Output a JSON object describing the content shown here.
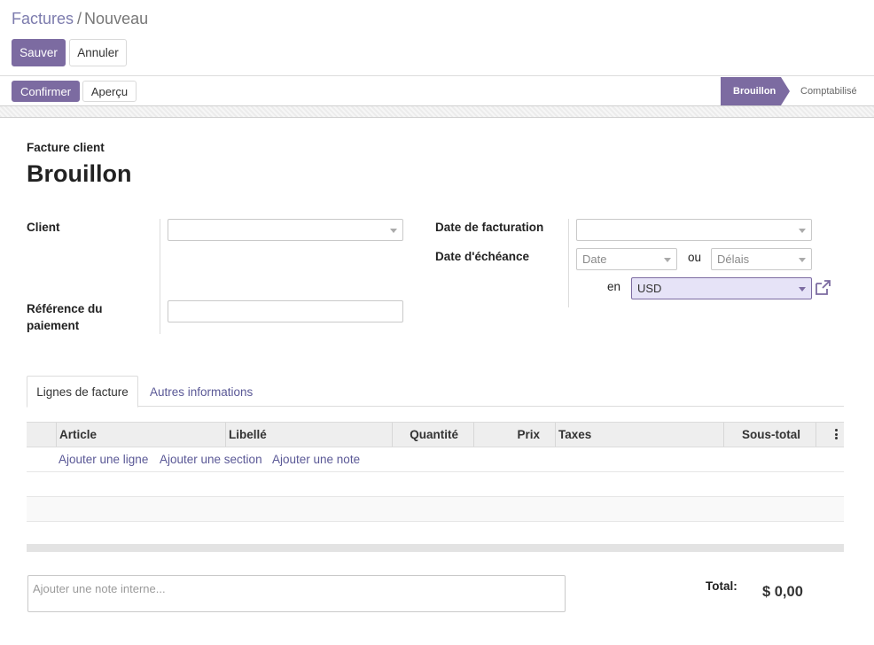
{
  "breadcrumb": {
    "parent": "Factures",
    "separator": "/",
    "current": "Nouveau"
  },
  "control_panel": {
    "save_label": "Sauver",
    "discard_label": "Annuler"
  },
  "statusbar": {
    "confirm_label": "Confirmer",
    "preview_label": "Aperçu",
    "stages": [
      {
        "label": "Brouillon",
        "active": true
      },
      {
        "label": "Comptabilisé",
        "active": false
      }
    ]
  },
  "form": {
    "doc_type": "Facture client",
    "title": "Brouillon",
    "client_label": "Client",
    "client_value": "",
    "payment_ref_label_line1": "Référence du",
    "payment_ref_label_line2": "paiement",
    "payment_ref_value": "",
    "invoice_date_label": "Date de facturation",
    "invoice_date_value": "",
    "due_date_label": "Date d'échéance",
    "due_date_placeholder": "Date",
    "or_label": "ou",
    "terms_placeholder": "Délais",
    "currency_prefix": "en",
    "currency_value": "USD"
  },
  "tabs": [
    {
      "label": "Lignes de facture",
      "active": true
    },
    {
      "label": "Autres informations",
      "active": false
    }
  ],
  "grid": {
    "columns": [
      "Article",
      "Libellé",
      "Quantité",
      "Prix",
      "Taxes",
      "Sous-total"
    ],
    "add_line": "Ajouter une ligne",
    "add_section": "Ajouter une section",
    "add_note": "Ajouter une note"
  },
  "footer": {
    "note_placeholder": "Ajouter une note interne...",
    "total_label": "Total:",
    "total_value": "$ 0,00"
  },
  "colors": {
    "accent": "#7c6ba1",
    "link": "#5a5896",
    "currency_highlight": "#e6e3f7"
  },
  "icons": {
    "external": "external-link-icon",
    "options": "kebab-menu-icon"
  }
}
